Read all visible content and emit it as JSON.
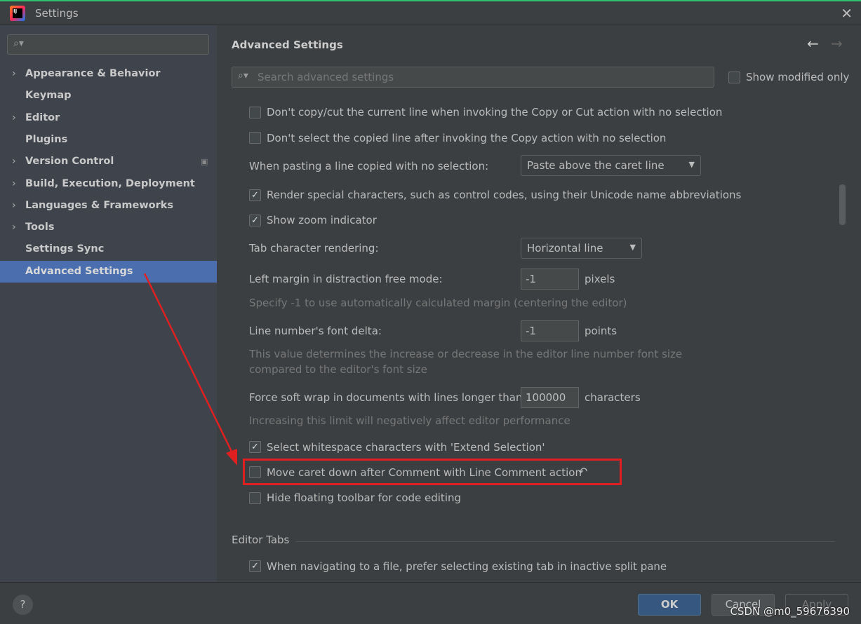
{
  "window": {
    "title": "Settings",
    "close": "✕"
  },
  "sidebar": {
    "search_placeholder": "",
    "items": [
      {
        "label": "Appearance & Behavior",
        "expandable": true
      },
      {
        "label": "Keymap",
        "expandable": false
      },
      {
        "label": "Editor",
        "expandable": true
      },
      {
        "label": "Plugins",
        "expandable": false
      },
      {
        "label": "Version Control",
        "expandable": true
      },
      {
        "label": "Build, Execution, Deployment",
        "expandable": true
      },
      {
        "label": "Languages & Frameworks",
        "expandable": true
      },
      {
        "label": "Tools",
        "expandable": true
      },
      {
        "label": "Settings Sync",
        "expandable": false
      },
      {
        "label": "Advanced Settings",
        "expandable": false,
        "selected": true
      }
    ]
  },
  "main": {
    "title": "Advanced Settings",
    "back": "←",
    "forward": "→",
    "search_placeholder": "Search advanced settings",
    "show_modified": "Show modified only",
    "rows": {
      "copy_cut": "Don't copy/cut the current line when invoking the Copy or Cut action with no selection",
      "select_copied": "Don't select the copied line after invoking the Copy action with no selection",
      "paste_label": "When pasting a line copied with no selection:",
      "paste_value": "Paste above the caret line",
      "render_special": "Render special characters, such as control codes, using their Unicode name abbreviations",
      "zoom_indicator": "Show zoom indicator",
      "tab_label": "Tab character rendering:",
      "tab_value": "Horizontal line",
      "left_margin_label": "Left margin in distraction free mode:",
      "left_margin_value": "-1",
      "left_margin_unit": "pixels",
      "left_margin_hint": "Specify -1 to use automatically calculated margin (centering the editor)",
      "font_delta_label": "Line number's font delta:",
      "font_delta_value": "-1",
      "font_delta_unit": "points",
      "font_delta_hint1": "This value determines the increase or decrease in the editor line number font size",
      "font_delta_hint2": "compared to the editor's font size",
      "soft_wrap_label": "Force soft wrap in documents with lines longer than:",
      "soft_wrap_value": "100000",
      "soft_wrap_unit": "characters",
      "soft_wrap_hint": "Increasing this limit will negatively affect editor performance",
      "whitespace": "Select whitespace characters with 'Extend Selection'",
      "move_caret": "Move caret down after Comment with Line Comment action",
      "reset": "↶",
      "hide_toolbar": "Hide floating toolbar for code editing",
      "section_editor_tabs": "Editor Tabs",
      "prefer_tab": "When navigating to a file, prefer selecting existing tab in inactive split pane"
    }
  },
  "footer": {
    "help": "?",
    "ok": "OK",
    "cancel": "Cancel",
    "apply": "Apply",
    "watermark": "CSDN @m0_59676390"
  },
  "colors": {
    "selection": "#4b6eaf",
    "highlight": "#e02020",
    "ok": "#365880"
  }
}
